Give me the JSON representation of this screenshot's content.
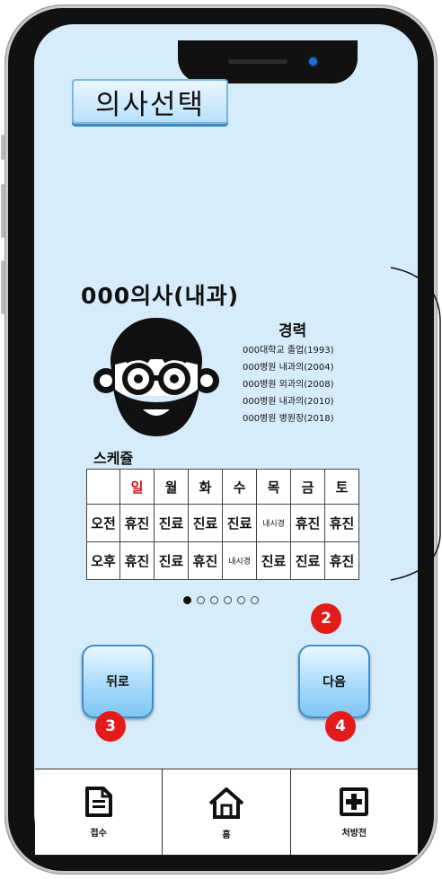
{
  "screen": {
    "title": "의사선택"
  },
  "doctor": {
    "name": "000의사(내과)",
    "career_title": "경력",
    "career": [
      "000대학교 졸업(1993)",
      "000병원 내과의(2004)",
      "000병원 외과의(2008)",
      "000병원 내과의(2010)",
      "000병원 병원장(2018)"
    ]
  },
  "schedule": {
    "title": "스케쥴",
    "days": [
      "일",
      "월",
      "화",
      "수",
      "목",
      "금",
      "토"
    ],
    "rows": [
      {
        "label": "오전",
        "cells": [
          "휴진",
          "진료",
          "진료",
          "진료",
          "내시경",
          "휴진",
          "휴진"
        ]
      },
      {
        "label": "오후",
        "cells": [
          "휴진",
          "진료",
          "휴진",
          "내시경",
          "진료",
          "진료",
          "휴진"
        ]
      }
    ]
  },
  "pagination": {
    "count": 6,
    "active": 0
  },
  "buttons": {
    "back": "뒤로",
    "next": "다음"
  },
  "badges": {
    "next_top": "2",
    "back_bottom": "3",
    "next_bottom": "4"
  },
  "tabs": [
    {
      "label": "접수",
      "icon": "document-icon"
    },
    {
      "label": "홈",
      "icon": "home-icon"
    },
    {
      "label": "처방전",
      "icon": "plus-box-icon"
    }
  ],
  "colors": {
    "screen_bg": "#d7ecfb",
    "badge": "#e31b1b",
    "sunday": "#d11111",
    "button_border": "#3d8fcc"
  }
}
